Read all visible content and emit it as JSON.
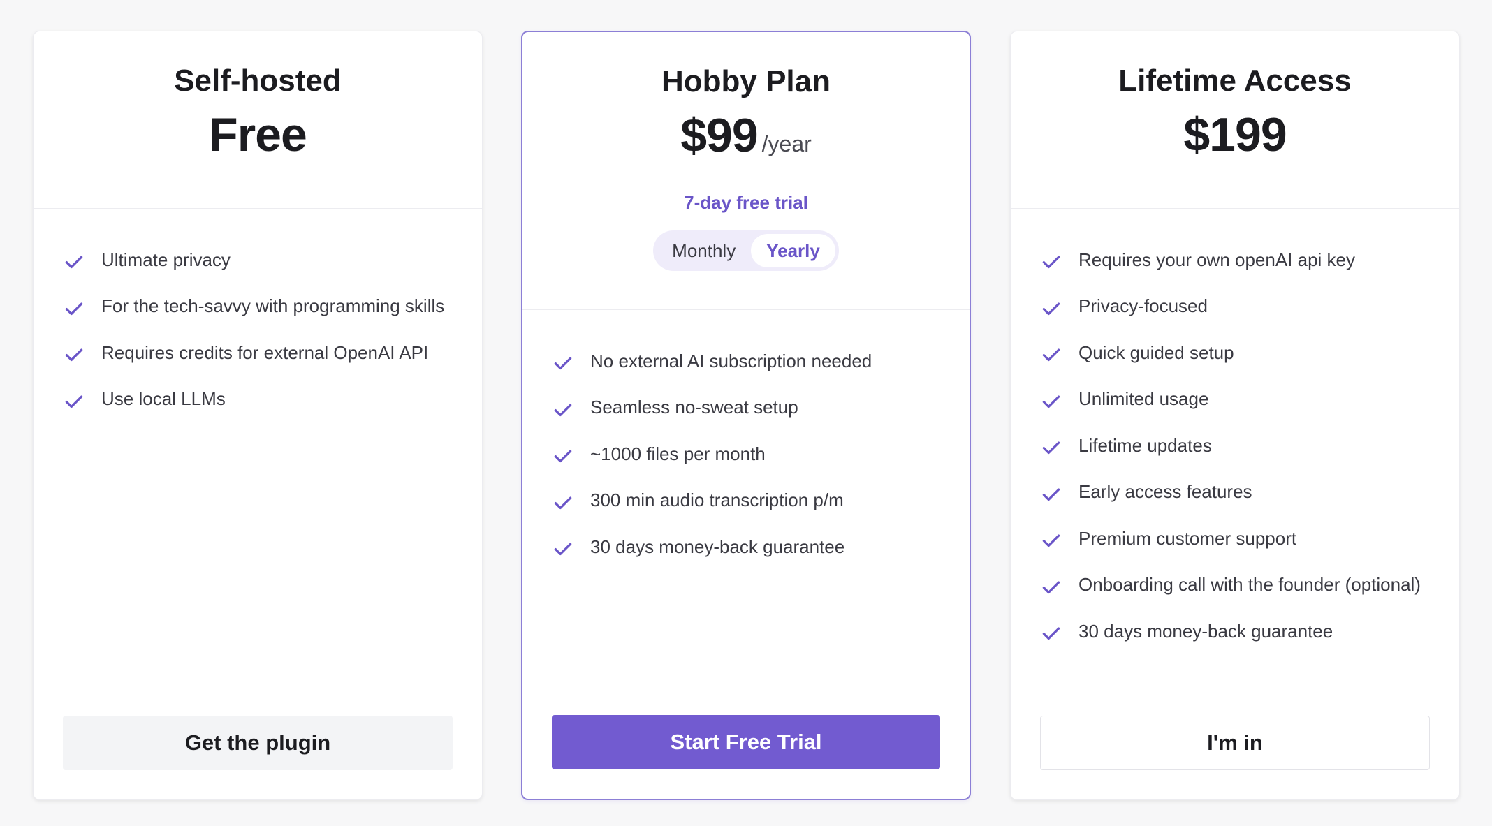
{
  "colors": {
    "accent": "#725bd0",
    "accent_text": "#6a55c8",
    "check": "#6a55c8"
  },
  "plans": [
    {
      "name": "Self-hosted",
      "price": "Free",
      "features": [
        "Ultimate privacy",
        "For the tech-savvy with programming skills",
        "Requires credits for external OpenAI API",
        "Use local LLMs"
      ],
      "button_label": "Get the plugin"
    },
    {
      "name": "Hobby Plan",
      "price": "$99",
      "period": "/year",
      "trial_text": "7-day free trial",
      "billing_toggle": {
        "options": [
          "Monthly",
          "Yearly"
        ],
        "selected": "Yearly"
      },
      "features": [
        "No external AI subscription needed",
        "Seamless no-sweat setup",
        "~1000 files per month",
        "300 min audio transcription p/m",
        "30 days money-back guarantee"
      ],
      "button_label": "Start Free Trial"
    },
    {
      "name": "Lifetime Access",
      "price": "$199",
      "features": [
        "Requires your own openAI api key",
        "Privacy-focused",
        "Quick guided setup",
        "Unlimited usage",
        "Lifetime updates",
        "Early access features",
        "Premium customer support",
        "Onboarding call with the founder (optional)",
        "30 days money-back guarantee"
      ],
      "button_label": "I'm in"
    }
  ],
  "icons": {
    "feature_bullet": "check-icon"
  }
}
